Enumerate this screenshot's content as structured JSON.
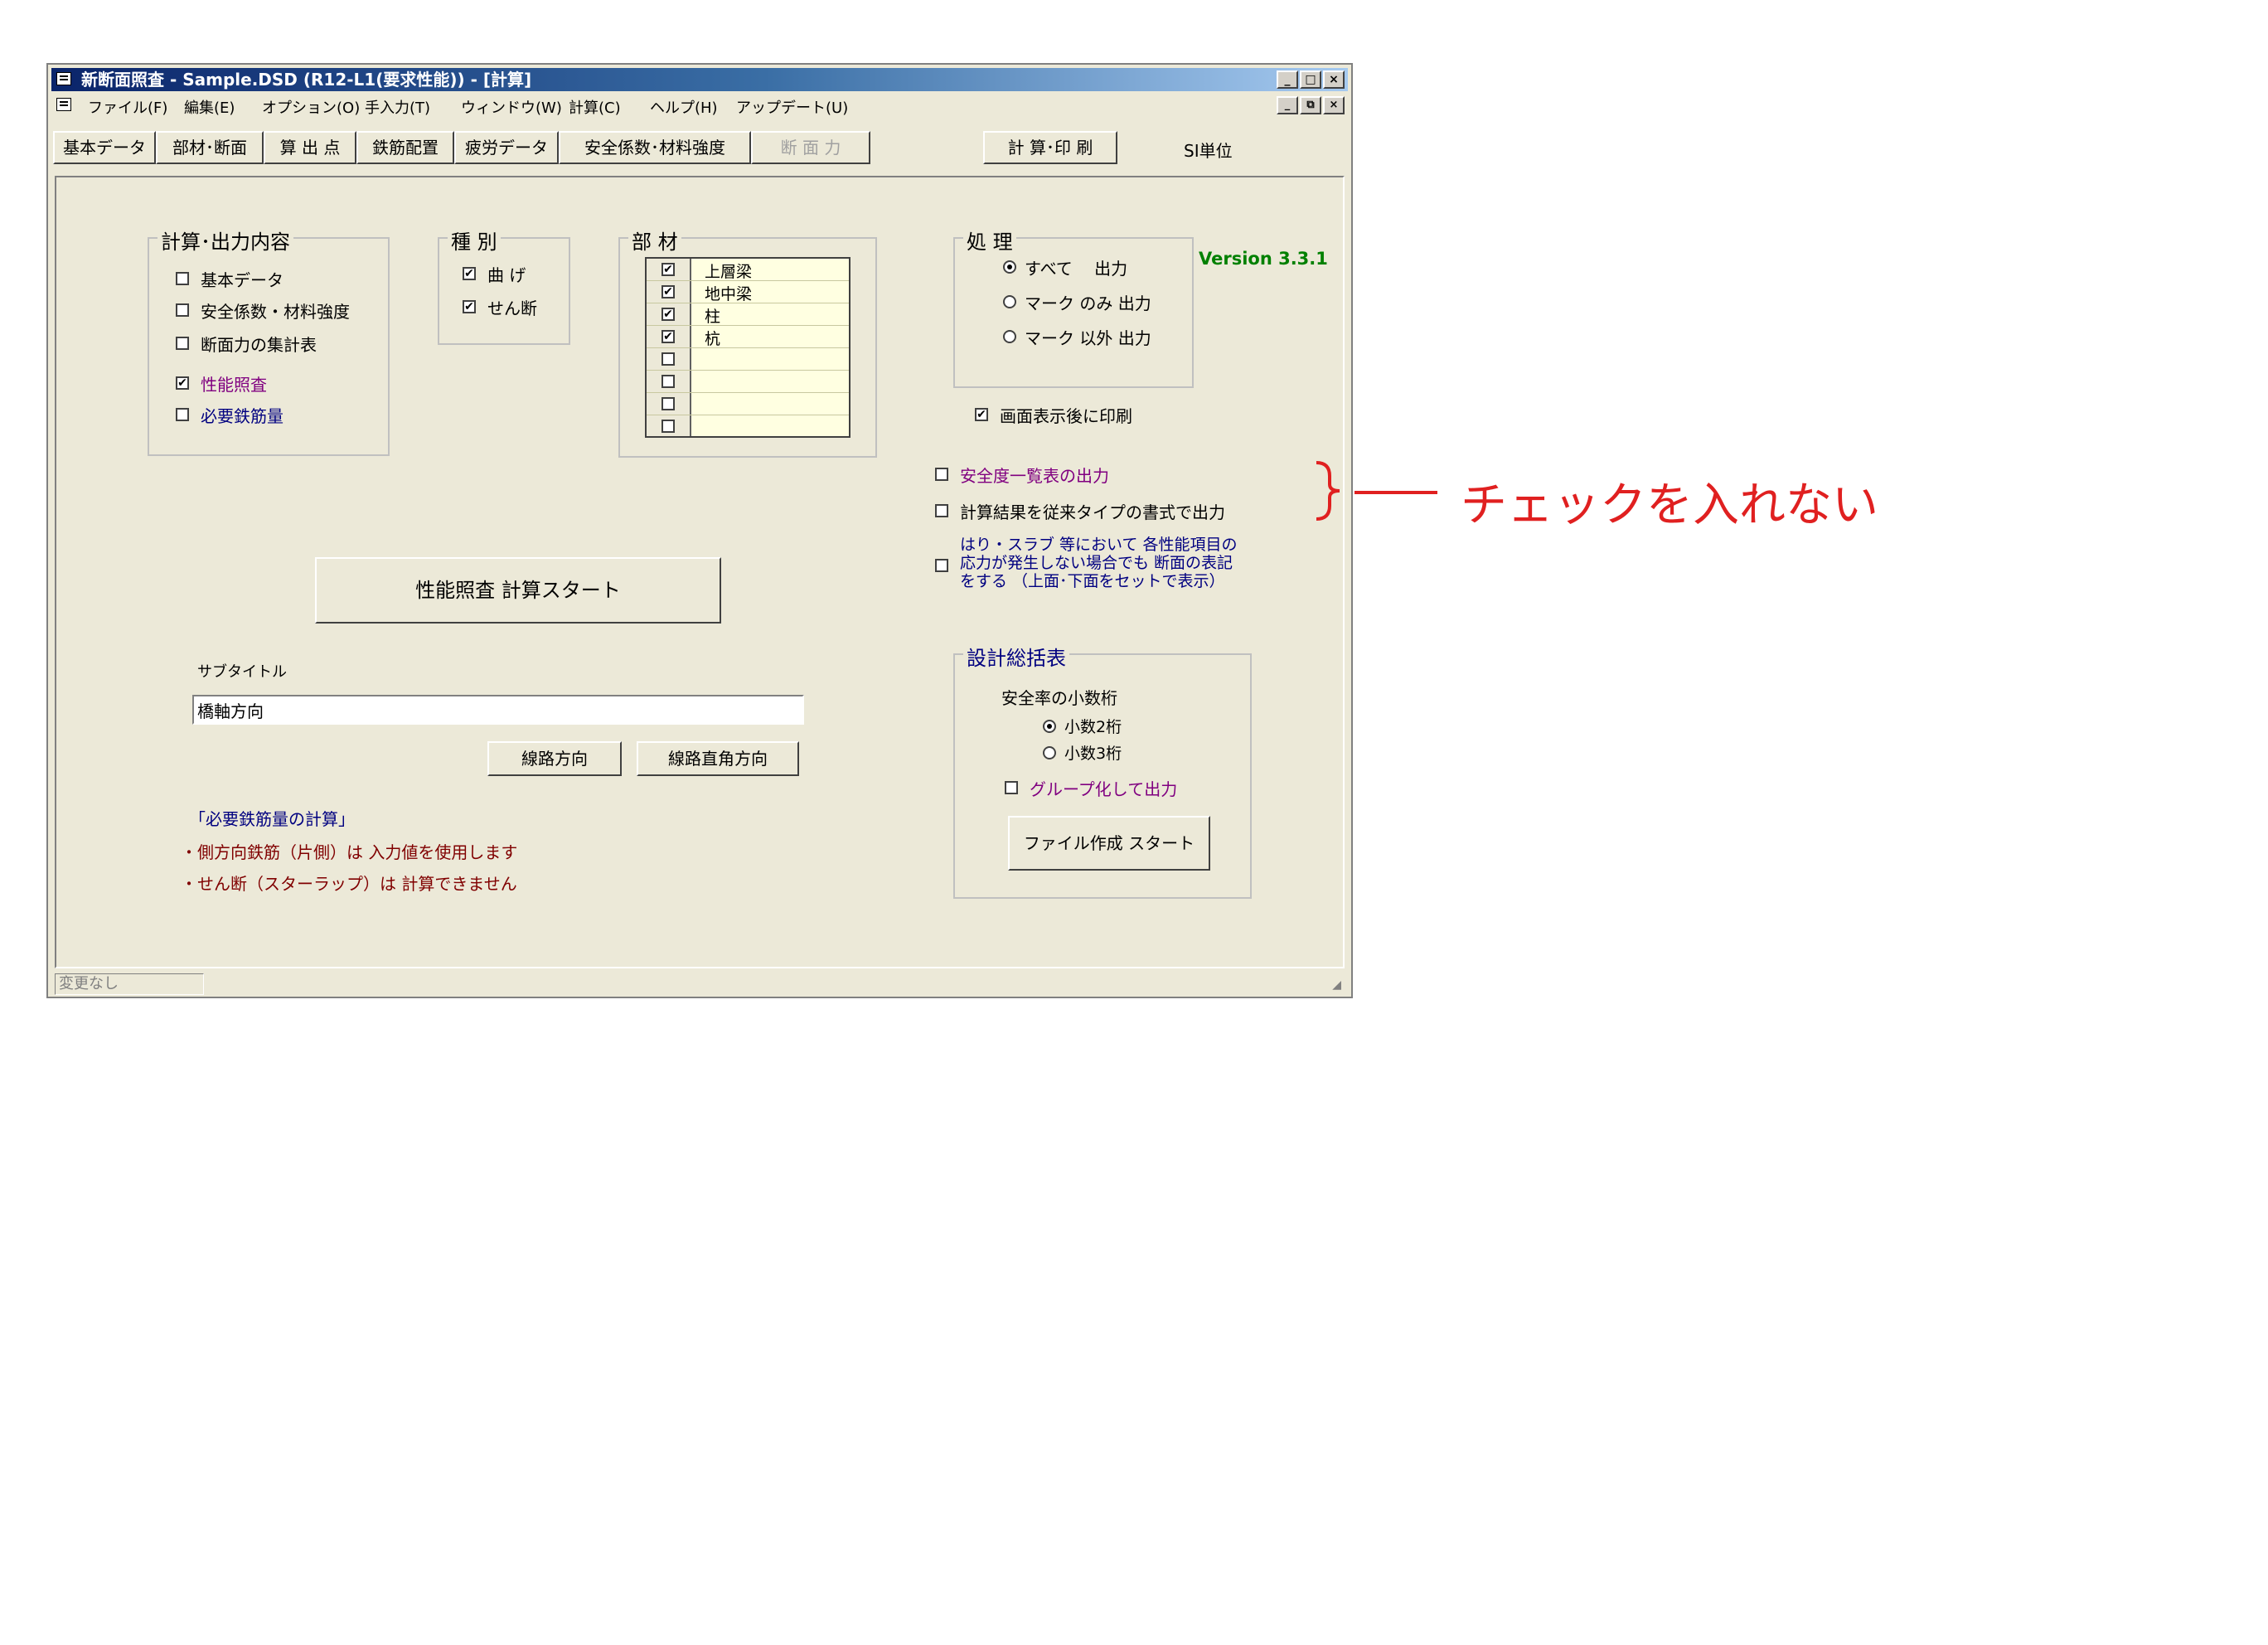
{
  "title": "新断面照査 - Sample.DSD (R12-L1(要求性能)) - [計算]",
  "caption_buttons": [
    "_",
    "□",
    "×"
  ],
  "mdi_buttons": [
    "_",
    "⧉",
    "×"
  ],
  "menu": [
    "ファイル(F)",
    "編集(E)",
    "オプション(O)",
    "手入力(T)",
    "ウィンドウ(W)",
    "計算(C)",
    "ヘルプ(H)",
    "アップデート(U)"
  ],
  "tabs": [
    "基本データ",
    "部材･断面",
    "算 出 点",
    "鉄筋配置",
    "疲労データ",
    "安全係数･材料強度",
    "断 面 力",
    "計 算･印 刷"
  ],
  "units_label": "SI単位",
  "version": "Version 3.3.1",
  "output_group": {
    "title": "計算･出力内容",
    "items": [
      {
        "label": "基本データ",
        "checked": false
      },
      {
        "label": "安全係数・材料強度",
        "checked": false
      },
      {
        "label": "断面力の集計表",
        "checked": false
      },
      {
        "label": "性能照査",
        "checked": true
      },
      {
        "label": "必要鉄筋量",
        "checked": false
      }
    ]
  },
  "type_group": {
    "title": "種 別",
    "items": [
      {
        "label": "曲 げ",
        "checked": true
      },
      {
        "label": "せん断",
        "checked": true
      }
    ]
  },
  "member_group": {
    "title": "部 材",
    "items": [
      {
        "name": "上層梁",
        "checked": true
      },
      {
        "name": "地中梁",
        "checked": true
      },
      {
        "name": "柱",
        "checked": true
      },
      {
        "name": "杭",
        "checked": true
      },
      {
        "name": "",
        "checked": false
      },
      {
        "name": "",
        "checked": false
      },
      {
        "name": "",
        "checked": false
      },
      {
        "name": "",
        "checked": false
      }
    ]
  },
  "process_group": {
    "title": "処 理",
    "options": [
      {
        "label": "すべて　 出力",
        "selected": true
      },
      {
        "label": "マーク のみ 出力",
        "selected": false
      },
      {
        "label": "マーク 以外 出力",
        "selected": false
      }
    ]
  },
  "print_after_display": {
    "label": "画面表示後に印刷",
    "checked": true
  },
  "safety_list_output": {
    "label": "安全度一覧表の出力",
    "checked": false
  },
  "legacy_format_output": {
    "label": "計算結果を従来タイプの書式で出力",
    "checked": false
  },
  "section_note_option": {
    "line1": "はり・スラブ 等において 各性能項目の",
    "line2": "応力が発生しない場合でも 断面の表記",
    "line3": "をする （上面･下面をセットで表示）",
    "checked": false
  },
  "start_button": "性能照査 計算スタート",
  "subtitle": {
    "label": "サブタイトル",
    "value": "橋軸方向"
  },
  "direction_buttons": [
    "線路方向",
    "線路直角方向"
  ],
  "rebar_notes": {
    "heading": "「必要鉄筋量の計算」",
    "line1": "・側方向鉄筋（片側）は 入力値を使用します",
    "line2": "・せん断（スターラップ）は 計算できません"
  },
  "summary_group": {
    "title": "設計総括表",
    "decimal_label": "安全率の小数桁",
    "decimal_options": [
      {
        "label": "小数2桁",
        "selected": true
      },
      {
        "label": "小数3桁",
        "selected": false
      }
    ],
    "group_output": {
      "label": "グループ化して出力",
      "checked": false
    },
    "file_button": "ファイル作成 スタート"
  },
  "status": "変更なし",
  "annotation": {
    "text": "チェックを入れない",
    "color": "#e02020"
  },
  "colors": {
    "title_bar": "#0a246a",
    "window_bg": "#ece9d8",
    "list_bg": "#ffffe1"
  }
}
